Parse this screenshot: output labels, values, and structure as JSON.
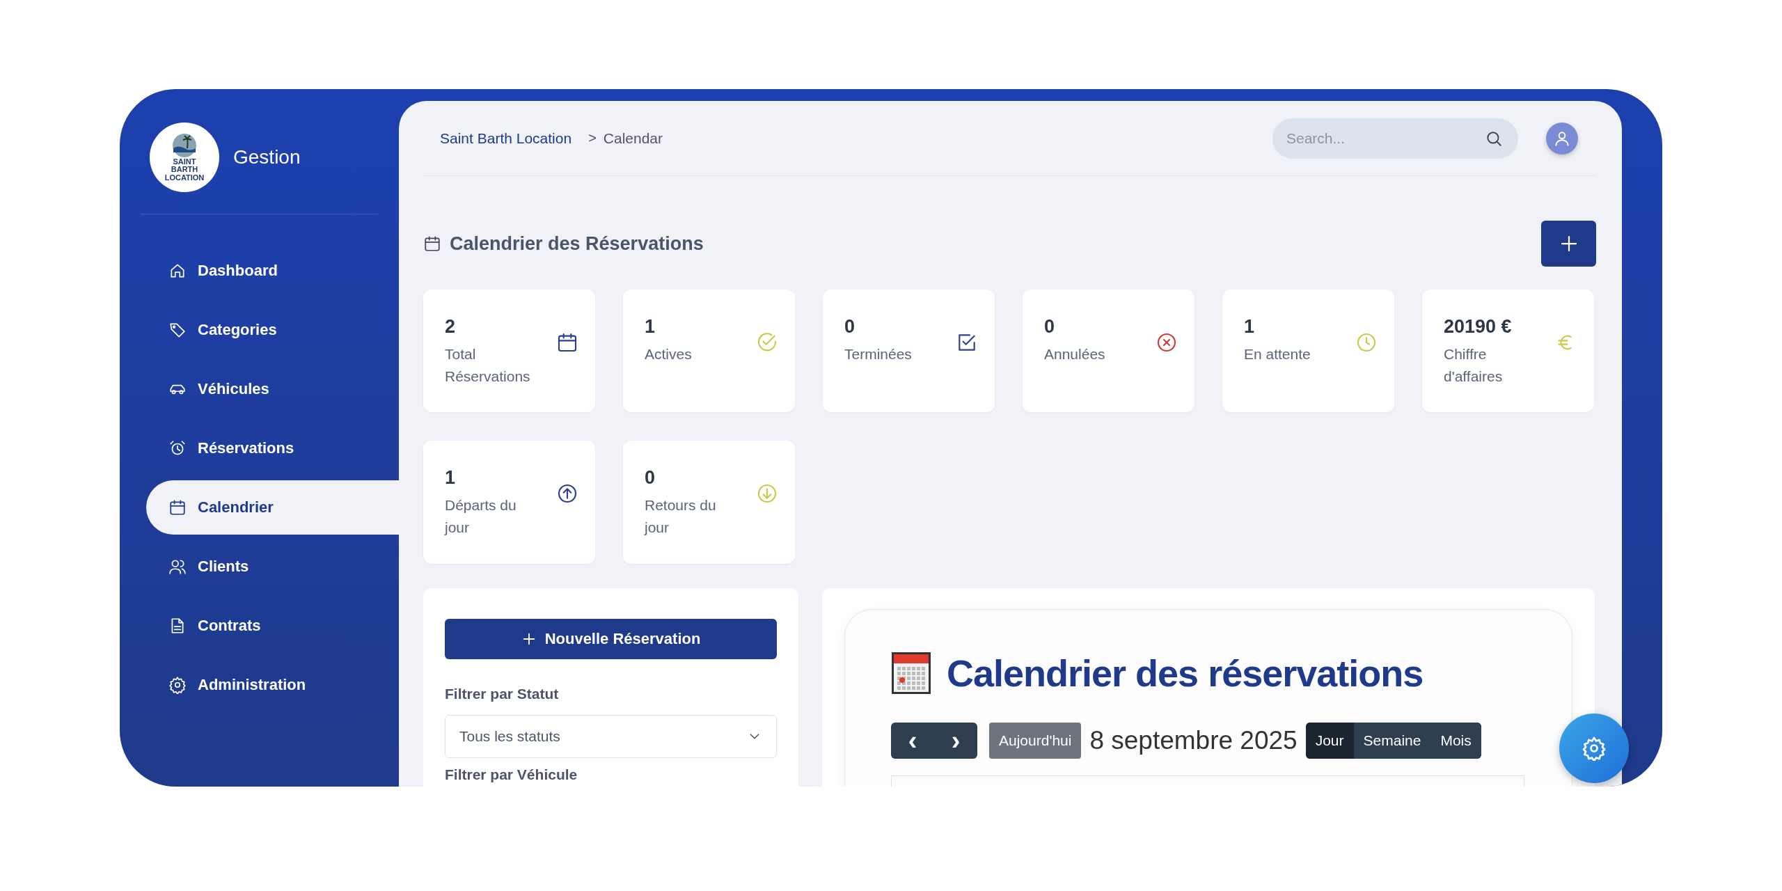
{
  "sidebar": {
    "brand": "Gestion",
    "logo_text": "SAINT BARTH LOCATION",
    "items": [
      {
        "label": "Dashboard",
        "selected": false
      },
      {
        "label": "Categories",
        "selected": false
      },
      {
        "label": "Véhicules",
        "selected": false
      },
      {
        "label": "Réservations",
        "selected": false
      },
      {
        "label": "Calendrier",
        "selected": true
      },
      {
        "label": "Clients",
        "selected": false
      },
      {
        "label": "Contrats",
        "selected": false
      },
      {
        "label": "Administration",
        "selected": false
      }
    ]
  },
  "breadcrumb": {
    "root": "Saint Barth Location",
    "separator": ">",
    "current": "Calendar"
  },
  "search": {
    "placeholder": "Search..."
  },
  "page_title": "Calendrier des Réservations",
  "stats": [
    {
      "value": "2",
      "label": "Total Réservations",
      "kind": "calendar",
      "color": "#2a3f8f"
    },
    {
      "value": "1",
      "label": "Actives",
      "kind": "check-circle",
      "color": "#c9c94a"
    },
    {
      "value": "0",
      "label": "Terminées",
      "kind": "check-square",
      "color": "#2a3f8f"
    },
    {
      "value": "0",
      "label": "Annulées",
      "kind": "x-circle",
      "color": "#d23b3b"
    },
    {
      "value": "1",
      "label": "En attente",
      "kind": "clock",
      "color": "#c9c94a"
    },
    {
      "value": "20190 €",
      "label": "Chiffre d'affaires",
      "kind": "euro",
      "color": "#c9c94a"
    },
    {
      "value": "1",
      "label": "Départs du jour",
      "kind": "arrow-up",
      "color": "#2a3f8f"
    },
    {
      "value": "0",
      "label": "Retours du jour",
      "kind": "arrow-down",
      "color": "#c9c94a"
    }
  ],
  "filters": {
    "new_button": "Nouvelle Réservation",
    "status_label": "Filtrer par Statut",
    "status_value": "Tous les statuts",
    "vehicle_label": "Filtrer par Véhicule"
  },
  "calendar": {
    "title": "Calendrier des réservations",
    "prev": "‹",
    "next": "›",
    "today": "Aujourd'hui",
    "date": "8 septembre 2025",
    "views": [
      {
        "label": "Jour",
        "selected": true
      },
      {
        "label": "Semaine",
        "selected": false
      },
      {
        "label": "Mois",
        "selected": false
      }
    ]
  }
}
